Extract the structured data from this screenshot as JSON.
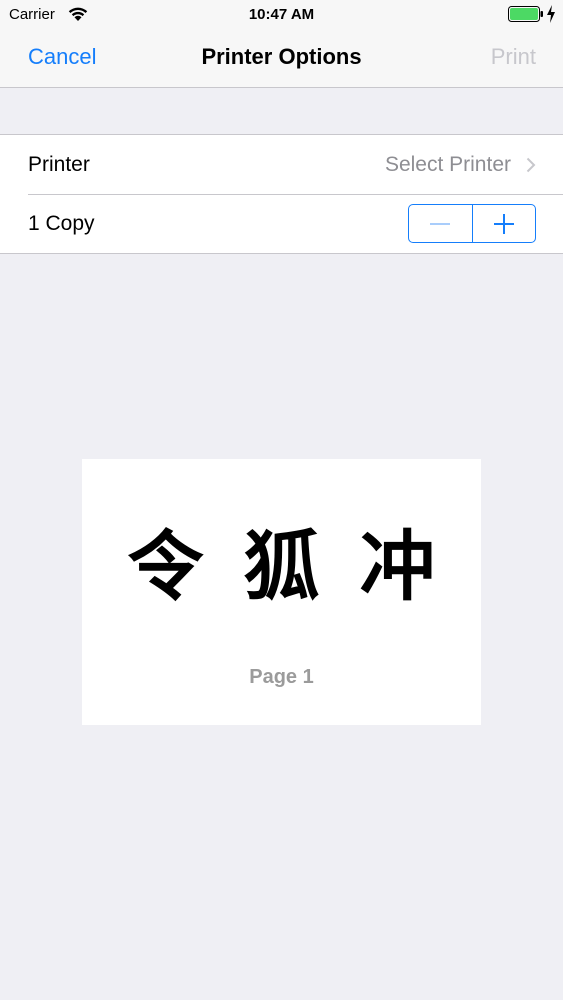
{
  "status_bar": {
    "carrier": "Carrier",
    "time": "10:47 AM",
    "icons": [
      "wifi-icon",
      "battery-icon",
      "charging-bolt-icon"
    ]
  },
  "nav": {
    "cancel_label": "Cancel",
    "title": "Printer Options",
    "print_label": "Print"
  },
  "settings": {
    "printer_label": "Printer",
    "printer_value": "Select Printer",
    "copies_label": "1 Copy",
    "stepper_icons": [
      "minus-icon",
      "plus-icon"
    ]
  },
  "preview": {
    "text": "令狐冲",
    "page_label": "Page 1"
  },
  "colors": {
    "accent": "#157efb",
    "disabled": "#c7c7cc",
    "background": "#efeff4",
    "secondary_text": "#8e8e93"
  }
}
